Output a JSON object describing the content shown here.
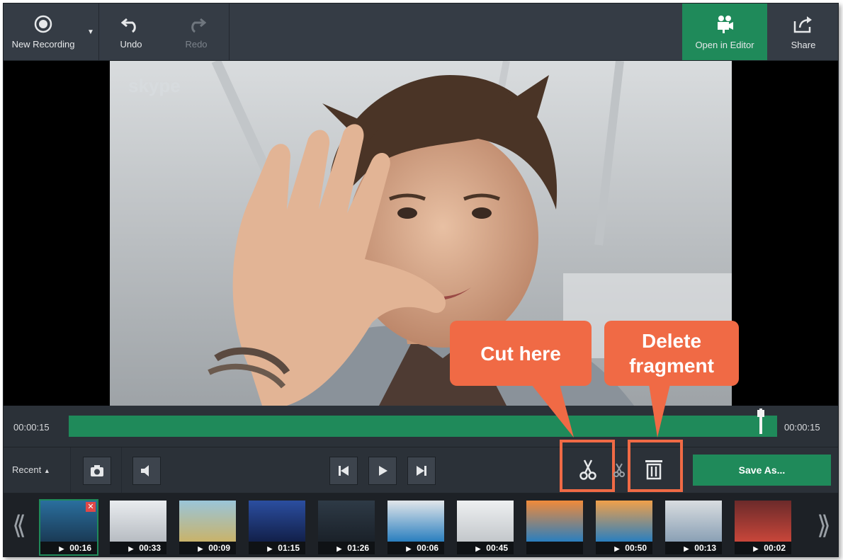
{
  "toolbar": {
    "new_recording": "New Recording",
    "undo": "Undo",
    "redo": "Redo",
    "open_in_editor": "Open in Editor",
    "share": "Share"
  },
  "viewer": {
    "watermark": "skype"
  },
  "timeline": {
    "start_time": "00:00:15",
    "end_time": "00:00:15"
  },
  "controls": {
    "recent": "Recent",
    "save_as": "Save As..."
  },
  "thumbnails": [
    {
      "duration": "00:16",
      "selected": true,
      "delete": "✕"
    },
    {
      "duration": "00:33"
    },
    {
      "duration": "00:09"
    },
    {
      "duration": "01:15"
    },
    {
      "duration": "01:26"
    },
    {
      "duration": "00:06"
    },
    {
      "duration": "00:45"
    },
    {
      "duration": ""
    },
    {
      "duration": "00:50"
    },
    {
      "duration": "00:13"
    },
    {
      "duration": "00:02"
    }
  ],
  "callouts": {
    "cut": "Cut here",
    "delete_line1": "Delete",
    "delete_line2": "fragment"
  },
  "colors": {
    "accent": "#1f8a5a",
    "callout": "#f06a45",
    "toolbar": "#353c45"
  }
}
